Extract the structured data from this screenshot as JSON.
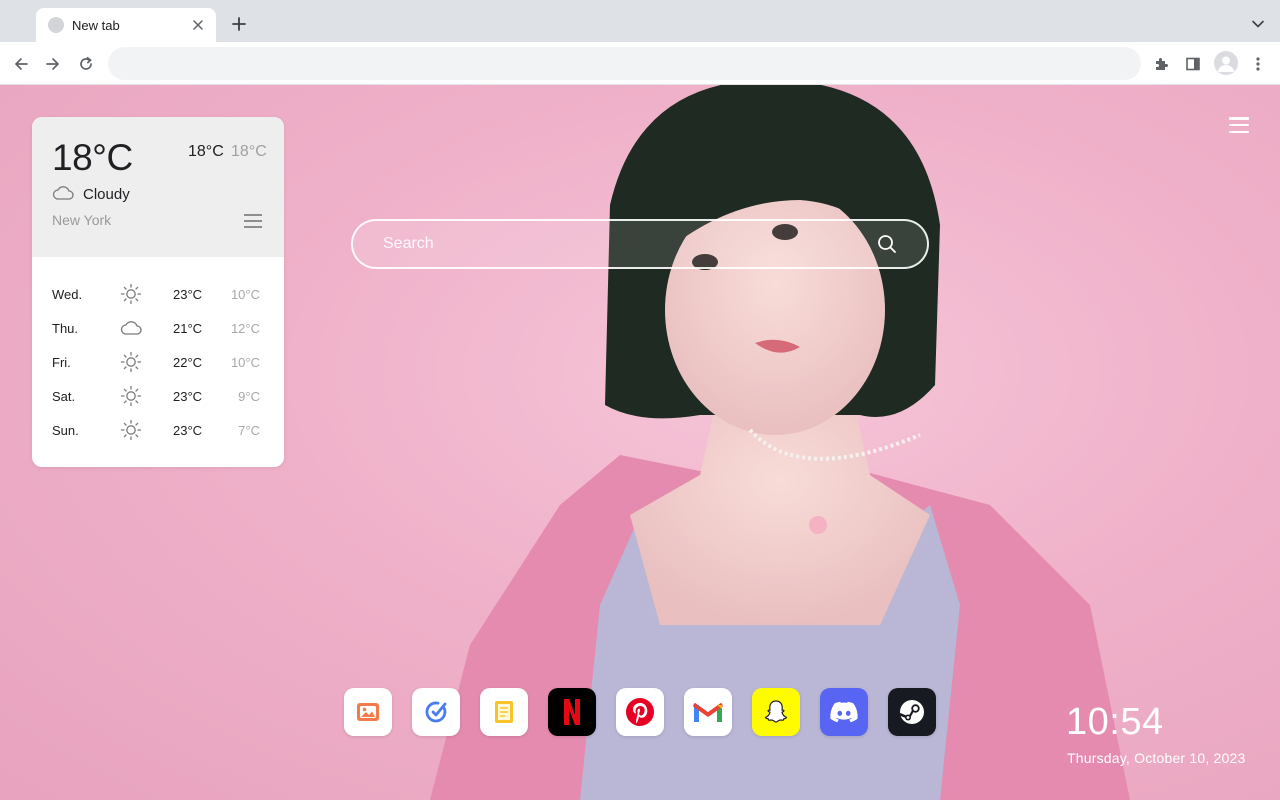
{
  "browser": {
    "tab_title": "New tab",
    "address_value": "",
    "icons": {
      "new_tab": "plus-icon",
      "tab_search": "chevron-down-icon",
      "back": "arrow-left-icon",
      "forward": "arrow-right-icon",
      "reload": "reload-icon",
      "extensions": "puzzle-icon",
      "side_panel": "side-panel-icon",
      "profile": "avatar-icon",
      "more": "kebab-menu-icon"
    }
  },
  "weather": {
    "current_temp": "18°C",
    "high": "18°C",
    "low": "18°C",
    "condition": "Cloudy",
    "condition_icon": "cloud-icon",
    "city": "New York",
    "forecast": [
      {
        "day": "Wed.",
        "icon": "sun-icon",
        "high": "23°C",
        "low": "10°C"
      },
      {
        "day": "Thu.",
        "icon": "cloud-icon",
        "high": "21°C",
        "low": "12°C"
      },
      {
        "day": "Fri.",
        "icon": "sun-icon",
        "high": "22°C",
        "low": "10°C"
      },
      {
        "day": "Sat.",
        "icon": "sun-icon",
        "high": "23°C",
        "low": "9°C"
      },
      {
        "day": "Sun.",
        "icon": "sun-icon",
        "high": "23°C",
        "low": "7°C"
      }
    ]
  },
  "search": {
    "placeholder": "Search"
  },
  "dock": {
    "apps": [
      {
        "icon": "gallery-icon",
        "bg": "#ffffff"
      },
      {
        "icon": "checkmark-app-icon",
        "bg": "#ffffff"
      },
      {
        "icon": "notes-icon",
        "bg": "#ffffff"
      },
      {
        "icon": "netflix-icon",
        "bg": "#000000"
      },
      {
        "icon": "pinterest-icon",
        "bg": "#ffffff"
      },
      {
        "icon": "gmail-icon",
        "bg": "#ffffff"
      },
      {
        "icon": "snapchat-icon",
        "bg": "#fffc00"
      },
      {
        "icon": "discord-icon",
        "bg": "#5865f2"
      },
      {
        "icon": "steam-icon",
        "bg": "#171a21"
      }
    ]
  },
  "clock": {
    "time": "10:54",
    "date": "Thursday, October 10, 2023"
  },
  "colors": {
    "wallpaper": "#efb1c9",
    "accent_white": "#ffffff"
  }
}
